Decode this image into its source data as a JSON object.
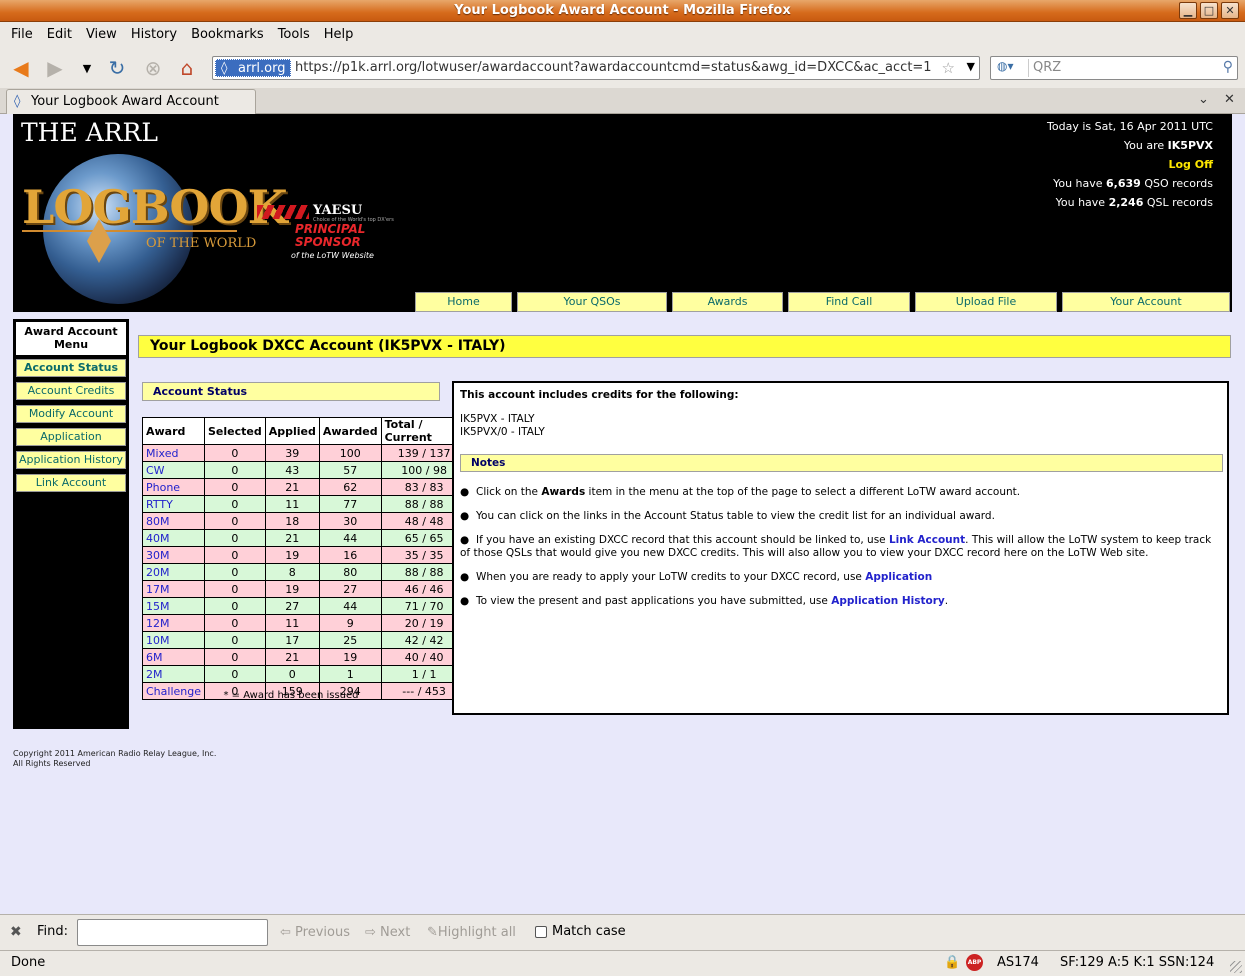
{
  "window": {
    "title": "Your Logbook Award Account - Mozilla Firefox"
  },
  "menubar": [
    "File",
    "Edit",
    "View",
    "History",
    "Bookmarks",
    "Tools",
    "Help"
  ],
  "navbar": {
    "site_label": "arrl.org",
    "url": "https://p1k.arrl.org/lotwuser/awardaccount?awardaccountcmd=status&awg_id=DXCC&ac_acct=1",
    "search_placeholder": "QRZ"
  },
  "tab": {
    "title": "Your Logbook Award Account"
  },
  "header": {
    "arrl": "THE ARRL",
    "logbook": "LOGBOOK",
    "of_the_world": "OF THE WORLD",
    "sponsor_brand": "YAESU",
    "sponsor_tagline": "Choice of the World's top DX'ers",
    "sponsor_principal": "PRINCIPAL",
    "sponsor_label": "SPONSOR",
    "sponsor_of": "of the LoTW Website",
    "date_text": "Today is Sat, 16 Apr 2011 UTC",
    "you_are_prefix": "You are ",
    "callsign": "IK5PVX",
    "logoff": "Log Off",
    "qso_prefix": "You have ",
    "qso_count": "6,639",
    "qso_suffix": " QSO records",
    "qsl_prefix": "You have ",
    "qsl_count": "2,246",
    "qsl_suffix": " QSL records"
  },
  "nav_tabs": [
    "Home",
    "Your QSOs",
    "Awards",
    "Find Call",
    "Upload File",
    "Your Account"
  ],
  "left_menu": {
    "title": "Award Account Menu",
    "items": [
      "Account Status",
      "Account Credits",
      "Modify Account",
      "Application",
      "Application History",
      "Link Account"
    ]
  },
  "main": {
    "title": "Your Logbook DXCC Account (IK5PVX - ITALY)",
    "status_head": "Account Status",
    "table": {
      "headers": [
        "Award",
        "Selected",
        "Applied",
        "Awarded",
        "Total / Current"
      ],
      "rows": [
        [
          "Mixed",
          "0",
          "39",
          "100",
          "139 / 137"
        ],
        [
          "CW",
          "0",
          "43",
          "57",
          "100 / 98"
        ],
        [
          "Phone",
          "0",
          "21",
          "62",
          "83 / 83"
        ],
        [
          "RTTY",
          "0",
          "11",
          "77",
          "88 / 88"
        ],
        [
          "80M",
          "0",
          "18",
          "30",
          "48 / 48"
        ],
        [
          "40M",
          "0",
          "21",
          "44",
          "65 / 65"
        ],
        [
          "30M",
          "0",
          "19",
          "16",
          "35 / 35"
        ],
        [
          "20M",
          "0",
          "8",
          "80",
          "88 / 88"
        ],
        [
          "17M",
          "0",
          "19",
          "27",
          "46 / 46"
        ],
        [
          "15M",
          "0",
          "27",
          "44",
          "71 / 70"
        ],
        [
          "12M",
          "0",
          "11",
          "9",
          "20 / 19"
        ],
        [
          "10M",
          "0",
          "17",
          "25",
          "42 / 42"
        ],
        [
          "6M",
          "0",
          "21",
          "19",
          "40 / 40"
        ],
        [
          "2M",
          "0",
          "0",
          "1",
          "1 / 1"
        ],
        [
          "Challenge",
          "0",
          "159",
          "294",
          "--- / 453"
        ]
      ]
    },
    "footnote": "* = Award has been issued",
    "includes_title": "This account includes credits for the following:",
    "callsigns": [
      "IK5PVX - ITALY",
      "IK5PVX/0 - ITALY"
    ],
    "notes_head": "Notes",
    "notes": [
      {
        "pre": "Click on the ",
        "bold": "Awards",
        "post": " item in the menu at the top of the page to select a different LoTW award account."
      },
      {
        "pre": "You can click on the links in the Account Status table to view the credit list for an individual award.",
        "bold": "",
        "post": ""
      },
      {
        "pre": "If you have an existing DXCC record that this account should be linked to, use ",
        "link": "Link Account",
        "post": ". This will allow the LoTW system to keep track of those QSLs that would give you new DXCC credits. This will also allow you to view your DXCC record here on the LoTW Web site."
      },
      {
        "pre": "When you are ready to apply your LoTW credits to your DXCC record, use ",
        "link": "Application",
        "post": ""
      },
      {
        "pre": "To view the present and past applications you have submitted, use ",
        "link": "Application History",
        "post": "."
      }
    ],
    "copyright_line1": "Copyright 2011 American Radio Relay League, Inc.",
    "copyright_line2": "All Rights Reserved"
  },
  "findbar": {
    "label": "Find:",
    "previous": "Previous",
    "next": "Next",
    "highlight": "Highlight all",
    "match_case": "Match case"
  },
  "statusbar": {
    "done": "Done",
    "as": "AS174",
    "solar": "SF:129 A:5 K:1 SSN:124",
    "abp": "ABP"
  }
}
